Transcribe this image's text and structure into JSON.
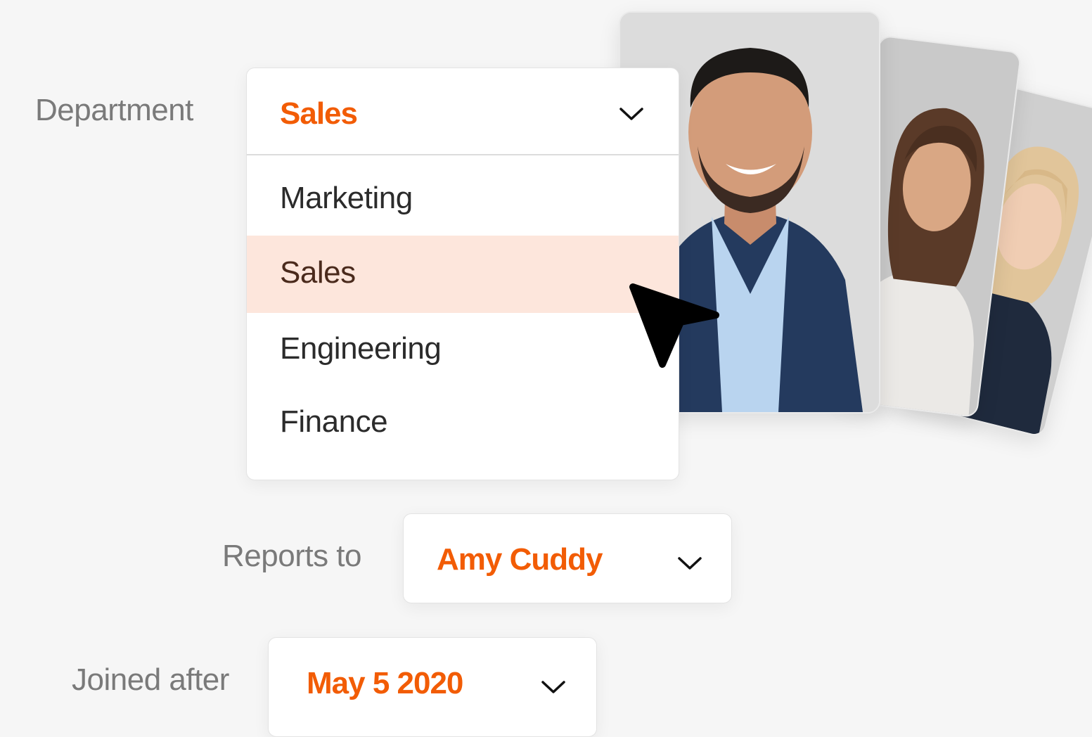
{
  "department": {
    "label": "Department",
    "selected": "Sales",
    "options": [
      "Marketing",
      "Sales",
      "Engineering",
      "Finance"
    ],
    "active_index": 1
  },
  "reports_to": {
    "label": "Reports to",
    "selected": "Amy Cuddy"
  },
  "joined_after": {
    "label": "Joined after",
    "selected": "May 5 2020"
  },
  "colors": {
    "accent": "#f25c05",
    "highlight": "#fde6dc",
    "label": "#7a7a7a"
  },
  "icons": [
    "chevron-down-icon",
    "cursor-arrow-icon"
  ],
  "photos": [
    "employee-photo-man",
    "employee-photo-woman-brown-hair",
    "employee-photo-woman-blonde"
  ]
}
